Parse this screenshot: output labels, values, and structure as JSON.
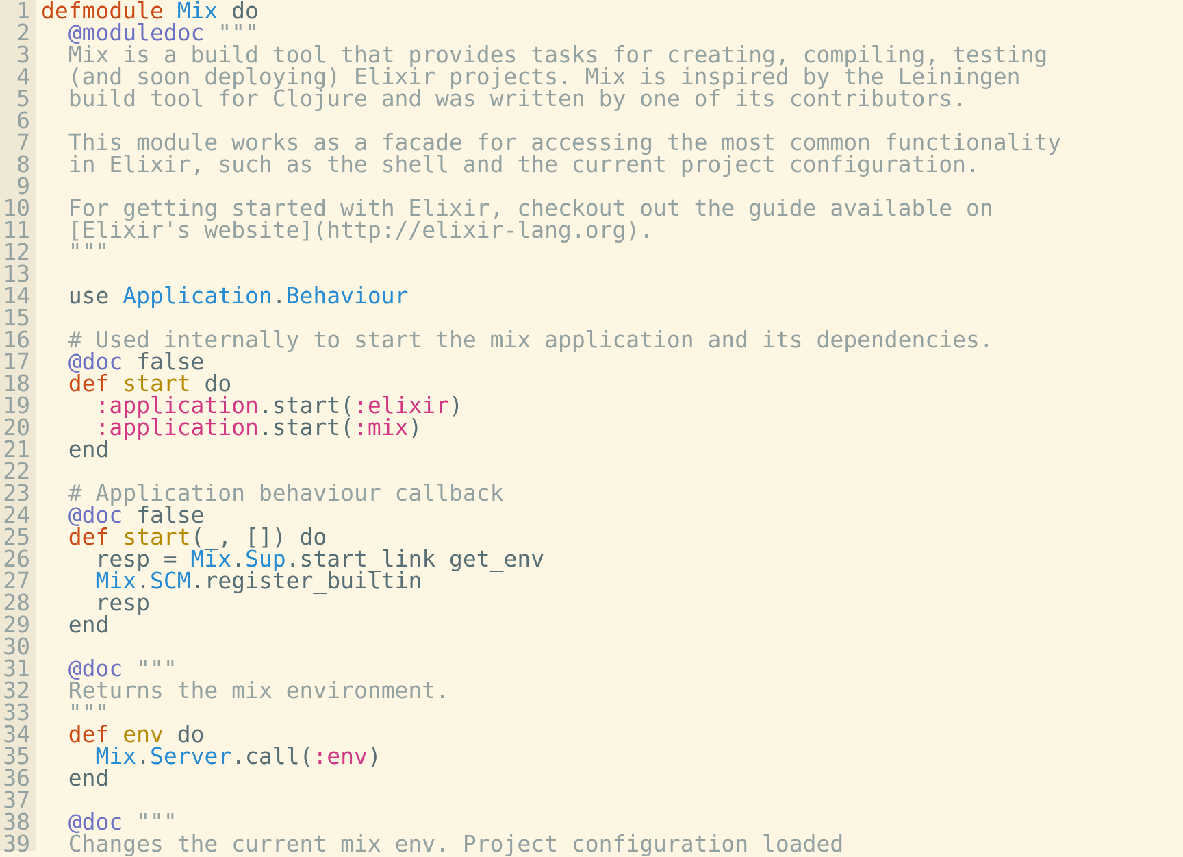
{
  "editor": {
    "theme_colors": {
      "background": "#fdf6e3",
      "gutter": "#eee8d5",
      "keyword": "#cb4b16",
      "module": "#268bd2",
      "text": "#586e75",
      "attribute": "#6c71c4",
      "string": "#93a1a1",
      "function": "#b58900",
      "atom": "#d33682"
    },
    "lines": [
      [
        [
          "kw",
          "defmodule"
        ],
        [
          "tx",
          " "
        ],
        [
          "mod",
          "Mix"
        ],
        [
          "tx",
          " do"
        ]
      ],
      [
        [
          "tx",
          "  "
        ],
        [
          "attr",
          "@moduledoc"
        ],
        [
          "str",
          " \"\"\""
        ]
      ],
      [
        [
          "str",
          "  Mix is a build tool that provides tasks for creating, compiling, testing"
        ]
      ],
      [
        [
          "str",
          "  (and soon deploying) Elixir projects. Mix is inspired by the Leiningen"
        ]
      ],
      [
        [
          "str",
          "  build tool for Clojure and was written by one of its contributors."
        ]
      ],
      [],
      [
        [
          "str",
          "  This module works as a facade for accessing the most common functionality"
        ]
      ],
      [
        [
          "str",
          "  in Elixir, such as the shell and the current project configuration."
        ]
      ],
      [],
      [
        [
          "str",
          "  For getting started with Elixir, checkout out the guide available on"
        ]
      ],
      [
        [
          "str",
          "  [Elixir's website](http://elixir-lang.org)."
        ]
      ],
      [
        [
          "str",
          "  \"\"\""
        ]
      ],
      [],
      [
        [
          "tx",
          "  use "
        ],
        [
          "mod",
          "Application"
        ],
        [
          "tx",
          "."
        ],
        [
          "mod",
          "Behaviour"
        ]
      ],
      [],
      [
        [
          "cm",
          "  # Used internally to start the mix application and its dependencies."
        ]
      ],
      [
        [
          "tx",
          "  "
        ],
        [
          "attr",
          "@doc"
        ],
        [
          "tx",
          " false"
        ]
      ],
      [
        [
          "tx",
          "  "
        ],
        [
          "kw",
          "def"
        ],
        [
          "tx",
          " "
        ],
        [
          "fn",
          "start"
        ],
        [
          "tx",
          " do"
        ]
      ],
      [
        [
          "tx",
          "    "
        ],
        [
          "atom",
          ":application"
        ],
        [
          "tx",
          ".start("
        ],
        [
          "atom",
          ":elixir"
        ],
        [
          "tx",
          ")"
        ]
      ],
      [
        [
          "tx",
          "    "
        ],
        [
          "atom",
          ":application"
        ],
        [
          "tx",
          ".start("
        ],
        [
          "atom",
          ":mix"
        ],
        [
          "tx",
          ")"
        ]
      ],
      [
        [
          "tx",
          "  end"
        ]
      ],
      [],
      [
        [
          "cm",
          "  # Application behaviour callback"
        ]
      ],
      [
        [
          "tx",
          "  "
        ],
        [
          "attr",
          "@doc"
        ],
        [
          "tx",
          " false"
        ]
      ],
      [
        [
          "tx",
          "  "
        ],
        [
          "kw",
          "def"
        ],
        [
          "tx",
          " "
        ],
        [
          "fn",
          "start"
        ],
        [
          "tx",
          "(_, []) do"
        ]
      ],
      [
        [
          "tx",
          "    resp = "
        ],
        [
          "mod",
          "Mix"
        ],
        [
          "tx",
          "."
        ],
        [
          "mod",
          "Sup"
        ],
        [
          "tx",
          ".start_link get_env"
        ]
      ],
      [
        [
          "tx",
          "    "
        ],
        [
          "mod",
          "Mix"
        ],
        [
          "tx",
          "."
        ],
        [
          "mod",
          "SCM"
        ],
        [
          "tx",
          ".register_builtin"
        ]
      ],
      [
        [
          "tx",
          "    resp"
        ]
      ],
      [
        [
          "tx",
          "  end"
        ]
      ],
      [],
      [
        [
          "tx",
          "  "
        ],
        [
          "attr",
          "@doc"
        ],
        [
          "str",
          " \"\"\""
        ]
      ],
      [
        [
          "str",
          "  Returns the mix environment."
        ]
      ],
      [
        [
          "str",
          "  \"\"\""
        ]
      ],
      [
        [
          "tx",
          "  "
        ],
        [
          "kw",
          "def"
        ],
        [
          "tx",
          " "
        ],
        [
          "fn",
          "env"
        ],
        [
          "tx",
          " do"
        ]
      ],
      [
        [
          "tx",
          "    "
        ],
        [
          "mod",
          "Mix"
        ],
        [
          "tx",
          "."
        ],
        [
          "mod",
          "Server"
        ],
        [
          "tx",
          ".call("
        ],
        [
          "atom",
          ":env"
        ],
        [
          "tx",
          ")"
        ]
      ],
      [
        [
          "tx",
          "  end"
        ]
      ],
      [],
      [
        [
          "tx",
          "  "
        ],
        [
          "attr",
          "@doc"
        ],
        [
          "str",
          " \"\"\""
        ]
      ],
      [
        [
          "str",
          "  Changes the current mix env. Project configuration loaded"
        ]
      ]
    ]
  }
}
